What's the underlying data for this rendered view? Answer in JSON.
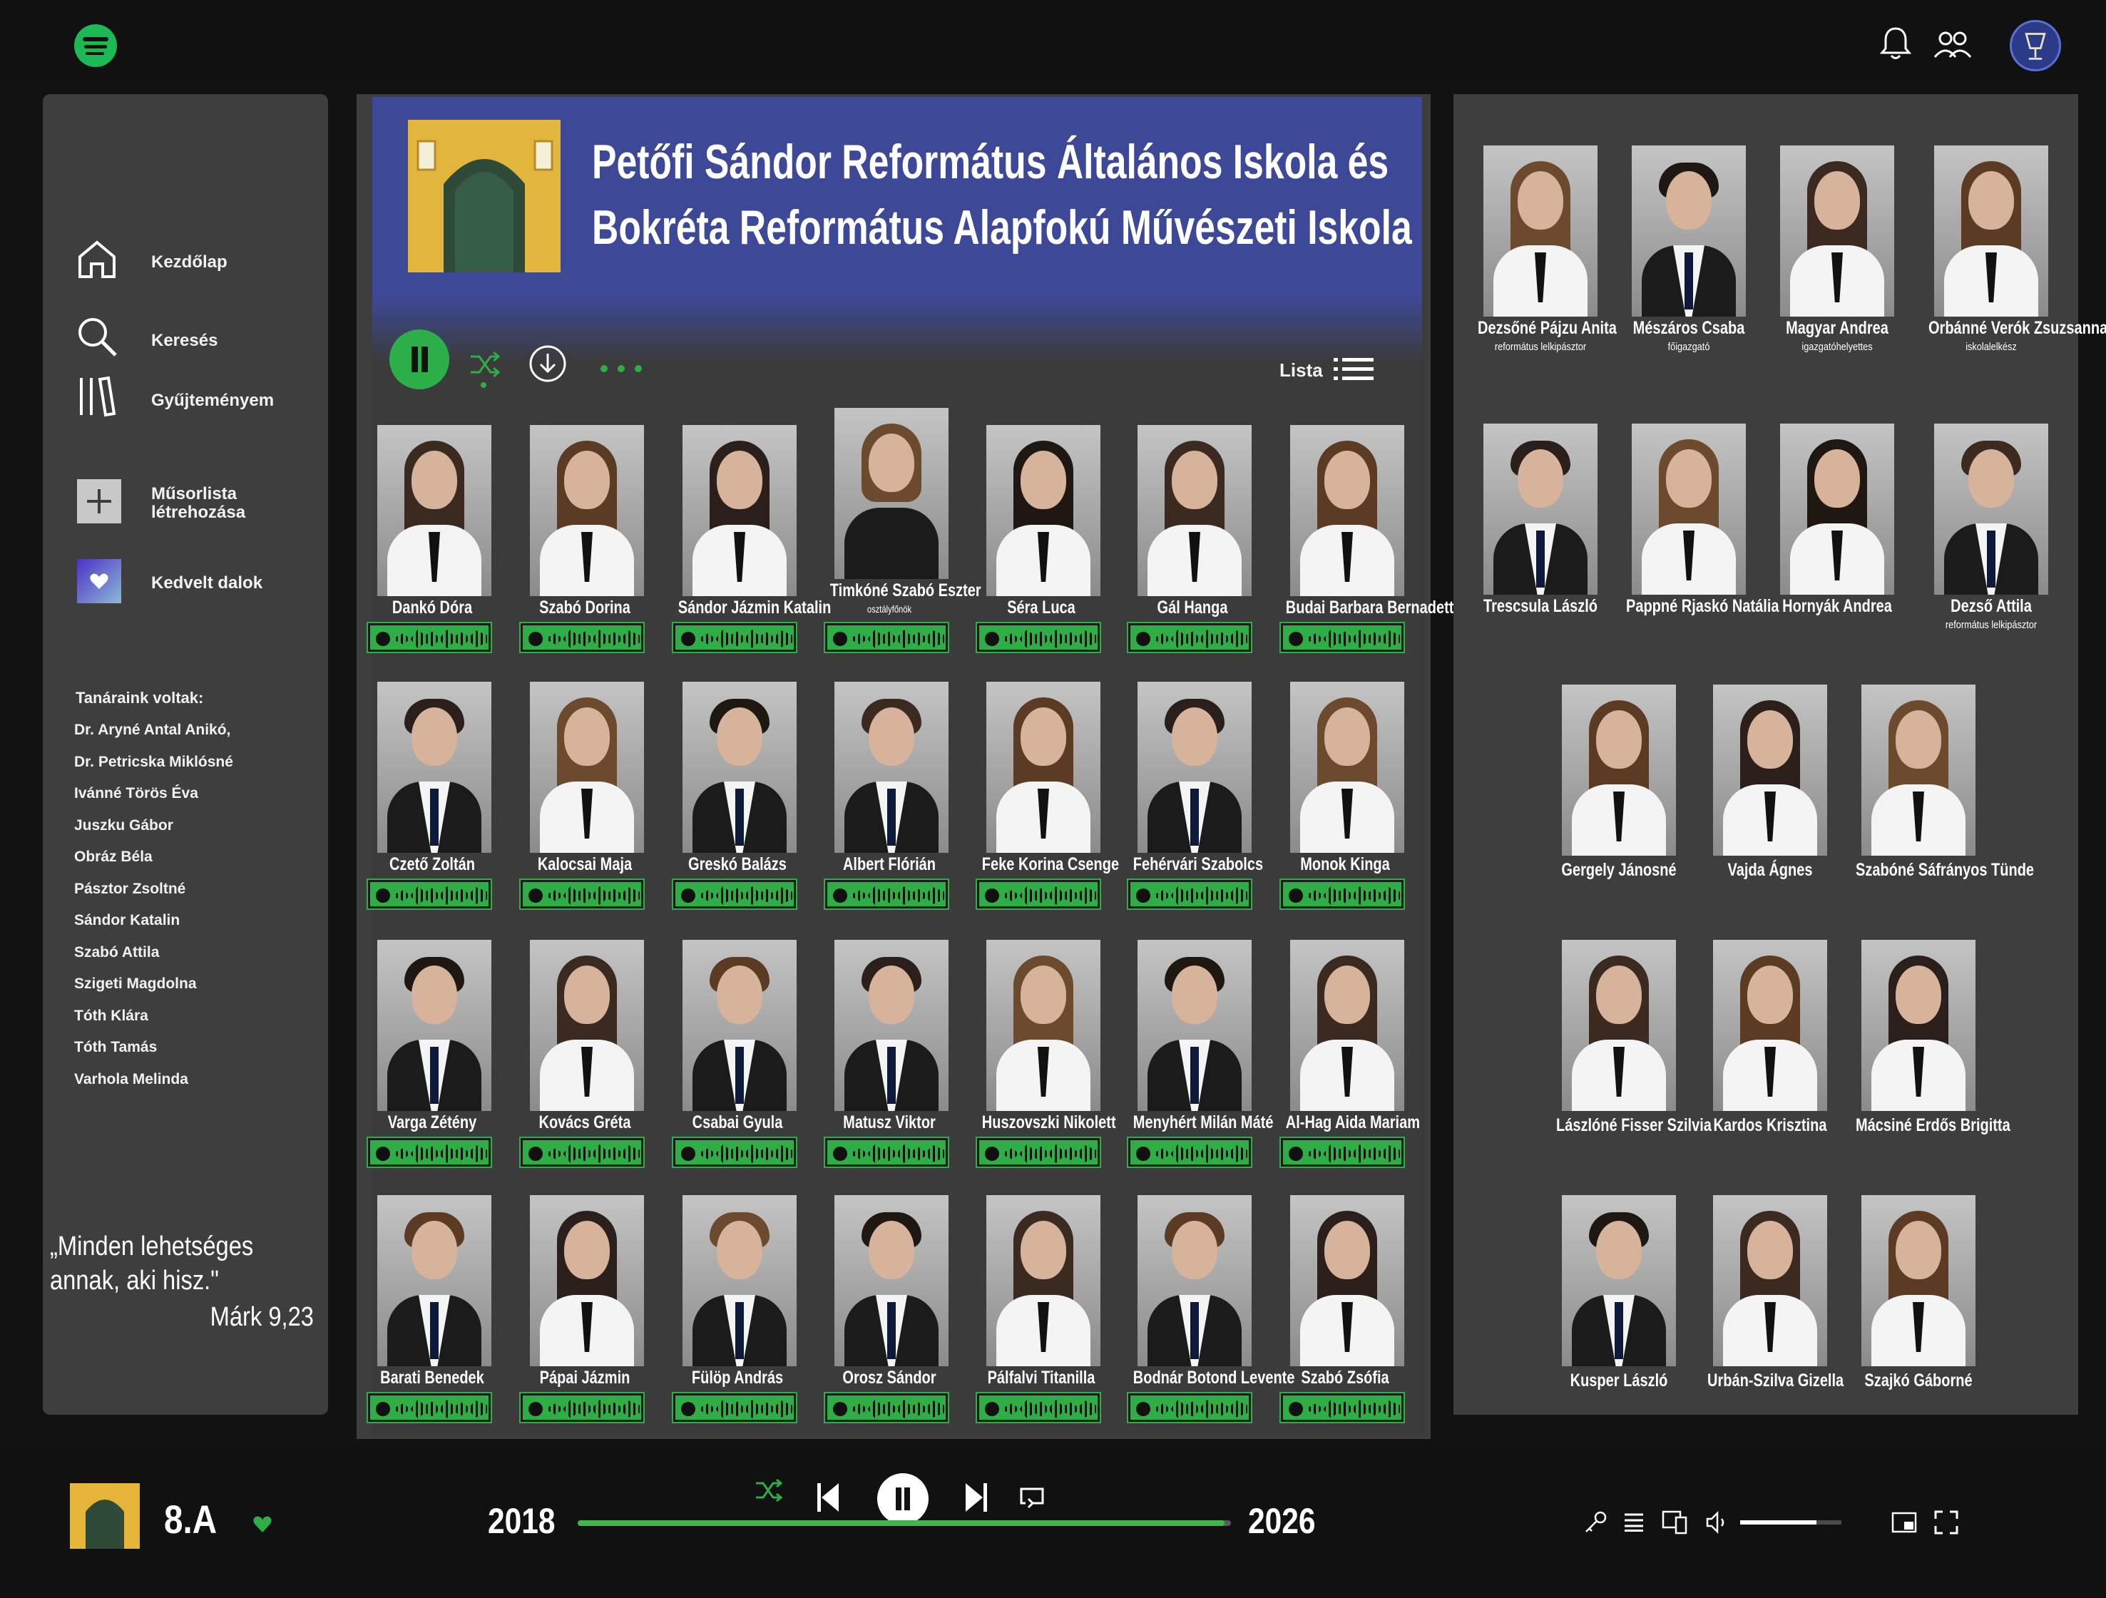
{
  "topbar": {
    "logo_icon": "spotify-logo",
    "icons": [
      "bell-icon",
      "friends-icon",
      "school-crest-avatar"
    ]
  },
  "sidebar": {
    "nav": [
      {
        "label": "Kezdőlap",
        "icon": "home-icon"
      },
      {
        "label": "Keresés",
        "icon": "search-icon"
      },
      {
        "label": "Gyűjteményem",
        "icon": "library-icon"
      },
      {
        "label": "Műsorlista\nlétrehozása",
        "icon": "plus-icon"
      },
      {
        "label": "Kedvelt dalok",
        "icon": "liked-heart-icon"
      }
    ],
    "former_teachers_title": "Tanáraink voltak:",
    "former_teachers": [
      "Dr. Aryné Antal Anikó,",
      "Dr. Petricska Miklósné",
      "Ivánné Törös Éva",
      "Juszku Gábor",
      "Obráz Béla",
      "Pásztor Zsoltné",
      "Sándor Katalin",
      "Szabó Attila",
      "Szigeti Magdolna",
      "Tóth Klára",
      "Tóth Tamás",
      "Varhola Melinda"
    ],
    "quote": "„Minden lehetséges annak, aki hisz.\"",
    "quote_ref": "Márk 9,23"
  },
  "banner": {
    "title_line1": "Petőfi Sándor Református Általános Iskola és",
    "title_line2": "Bokréta Református Alapfokú Művészeti Iskola",
    "list_label": "Lista"
  },
  "students": [
    [
      {
        "name": "Dankó Dóra",
        "g": "f"
      },
      {
        "name": "Szabó Dorina",
        "g": "f"
      },
      {
        "name": "Sándor Jázmin Katalin",
        "g": "f"
      },
      {
        "name": "Timkóné Szabó Eszter",
        "sub": "osztályfőnök",
        "g": "t"
      },
      {
        "name": "Séra Luca",
        "g": "f"
      },
      {
        "name": "Gál Hanga",
        "g": "f"
      },
      {
        "name": "Budai Barbara Bernadett",
        "g": "f"
      }
    ],
    [
      {
        "name": "Czető Zoltán",
        "g": "m"
      },
      {
        "name": "Kalocsai Maja",
        "g": "f"
      },
      {
        "name": "Greskó Balázs",
        "g": "m"
      },
      {
        "name": "Albert Flórián",
        "g": "m"
      },
      {
        "name": "Feke Korina Csenge",
        "g": "f"
      },
      {
        "name": "Fehérvári Szabolcs",
        "g": "m"
      },
      {
        "name": "Monok Kinga",
        "g": "f"
      }
    ],
    [
      {
        "name": "Varga Zétény",
        "g": "m"
      },
      {
        "name": "Kovács Gréta",
        "g": "f"
      },
      {
        "name": "Csabai Gyula",
        "g": "m"
      },
      {
        "name": "Matusz Viktor",
        "g": "m"
      },
      {
        "name": "Huszovszki Nikolett",
        "g": "f"
      },
      {
        "name": "Menyhért Milán Máté",
        "g": "m"
      },
      {
        "name": "Al-Hag Aida Mariam",
        "g": "f"
      }
    ],
    [
      {
        "name": "Barati Benedek",
        "g": "m"
      },
      {
        "name": "Pápai Jázmin",
        "g": "f"
      },
      {
        "name": "Fülöp András",
        "g": "m"
      },
      {
        "name": "Orosz Sándor",
        "g": "m"
      },
      {
        "name": "Pálfalvi Titanilla",
        "g": "f"
      },
      {
        "name": "Bodnár Botond Levente",
        "g": "m"
      },
      {
        "name": "Szabó Zsófia",
        "g": "f"
      }
    ]
  ],
  "staff": [
    [
      {
        "name": "Dezsőné Pájzu Anita",
        "role": "református lelkipásztor",
        "g": "f"
      },
      {
        "name": "Mészáros Csaba",
        "role": "főigazgató",
        "g": "m"
      },
      {
        "name": "Magyar Andrea",
        "role": "igazgatóhelyettes",
        "g": "f"
      },
      {
        "name": "Orbánné Verók Zsuzsanna",
        "role": "iskolalelkész",
        "g": "f"
      }
    ],
    [
      {
        "name": "Trescsula László",
        "g": "m"
      },
      {
        "name": "Pappné Rjaskó Natália",
        "g": "f"
      },
      {
        "name": "Hornyák Andrea",
        "g": "f"
      },
      {
        "name": "Dezső Attila",
        "role": "református lelkipásztor",
        "g": "m"
      }
    ],
    [
      {
        "name": "Gergely Jánosné",
        "g": "f"
      },
      {
        "name": "Vajda Ágnes",
        "g": "f"
      },
      {
        "name": "Szabóné Sáfrányos Tünde",
        "g": "f"
      }
    ],
    [
      {
        "name": "Lászlóné Fisser Szilvia",
        "g": "f"
      },
      {
        "name": "Kardos Krisztina",
        "g": "f"
      },
      {
        "name": "Mácsiné Erdős Brigitta",
        "g": "f"
      }
    ],
    [
      {
        "name": "Kusper László",
        "g": "m"
      },
      {
        "name": "Urbán-Szilva Gizella",
        "g": "f"
      },
      {
        "name": "Szajkó Gáborné",
        "g": "f"
      }
    ]
  ],
  "player": {
    "class_label": "8.A",
    "year_start": "2018",
    "year_end": "2026",
    "progress": 0.99,
    "volume": 0.75
  },
  "colors": {
    "accent": "#2fad47",
    "banner": "#3d4996",
    "panel": "#3e3e3e",
    "background": "#121212"
  }
}
